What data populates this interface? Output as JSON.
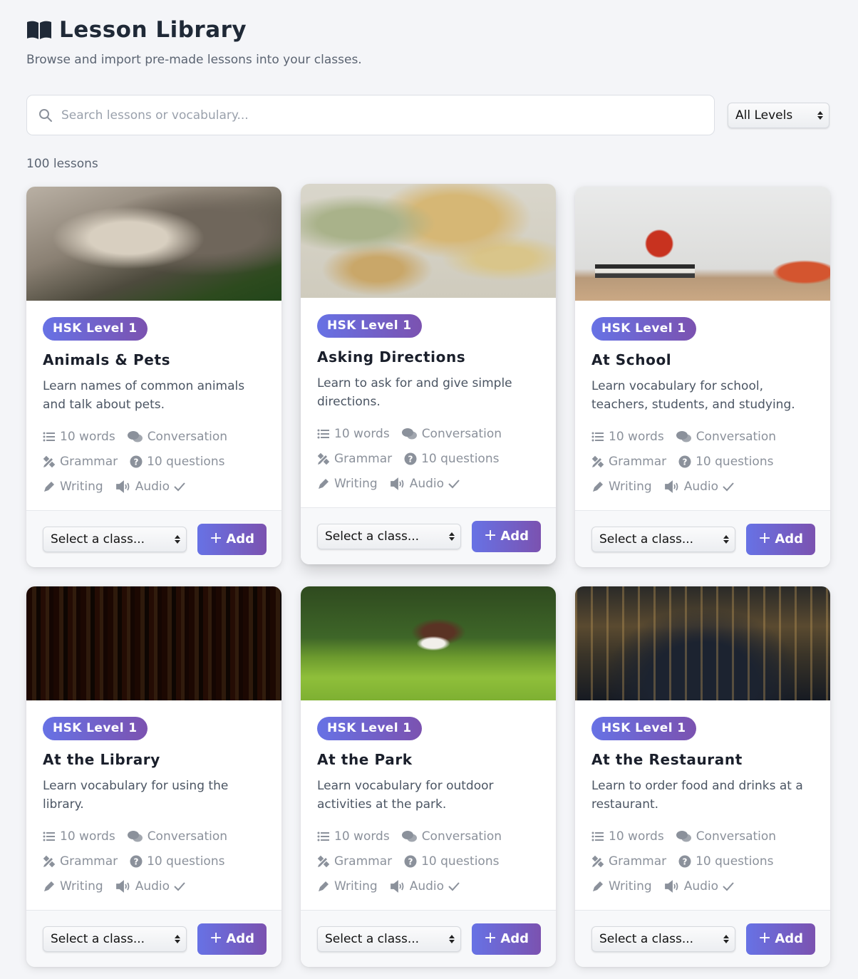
{
  "page": {
    "title": "Lesson Library",
    "subtitle": "Browse and import pre-made lessons into your classes.",
    "title_icon": "open-book-icon"
  },
  "search": {
    "placeholder": "Search lessons or vocabulary...",
    "value": ""
  },
  "level_filter": {
    "selected": "All Levels"
  },
  "lesson_count": "100 lessons",
  "colors": {
    "accent_start": "#6772e5",
    "accent_end": "#7b52b0",
    "background": "#f4f5f8"
  },
  "lessons": [
    {
      "level": "HSK Level 1",
      "title": "Animals & Pets",
      "description": "Learn names of common animals and talk about pets.",
      "words": "10 words",
      "conversation": "Conversation",
      "grammar": "Grammar",
      "questions": "10 questions",
      "writing": "Writing",
      "audio": "Audio",
      "class_select": "Select a class...",
      "add_label": "Add"
    },
    {
      "level": "HSK Level 1",
      "title": "Asking Directions",
      "description": "Learn to ask for and give simple directions.",
      "words": "10 words",
      "conversation": "Conversation",
      "grammar": "Grammar",
      "questions": "10 questions",
      "writing": "Writing",
      "audio": "Audio",
      "class_select": "Select a class...",
      "add_label": "Add"
    },
    {
      "level": "HSK Level 1",
      "title": "At School",
      "description": "Learn vocabulary for school, teachers, students, and studying.",
      "words": "10 words",
      "conversation": "Conversation",
      "grammar": "Grammar",
      "questions": "10 questions",
      "writing": "Writing",
      "audio": "Audio",
      "class_select": "Select a class...",
      "add_label": "Add"
    },
    {
      "level": "HSK Level 1",
      "title": "At the Library",
      "description": "Learn vocabulary for using the library.",
      "words": "10 words",
      "conversation": "Conversation",
      "grammar": "Grammar",
      "questions": "10 questions",
      "writing": "Writing",
      "audio": "Audio",
      "class_select": "Select a class...",
      "add_label": "Add"
    },
    {
      "level": "HSK Level 1",
      "title": "At the Park",
      "description": "Learn vocabulary for outdoor activities at the park.",
      "words": "10 words",
      "conversation": "Conversation",
      "grammar": "Grammar",
      "questions": "10 questions",
      "writing": "Writing",
      "audio": "Audio",
      "class_select": "Select a class...",
      "add_label": "Add"
    },
    {
      "level": "HSK Level 1",
      "title": "At the Restaurant",
      "description": "Learn to order food and drinks at a restaurant.",
      "words": "10 words",
      "conversation": "Conversation",
      "grammar": "Grammar",
      "questions": "10 questions",
      "writing": "Writing",
      "audio": "Audio",
      "class_select": "Select a class...",
      "add_label": "Add"
    }
  ]
}
